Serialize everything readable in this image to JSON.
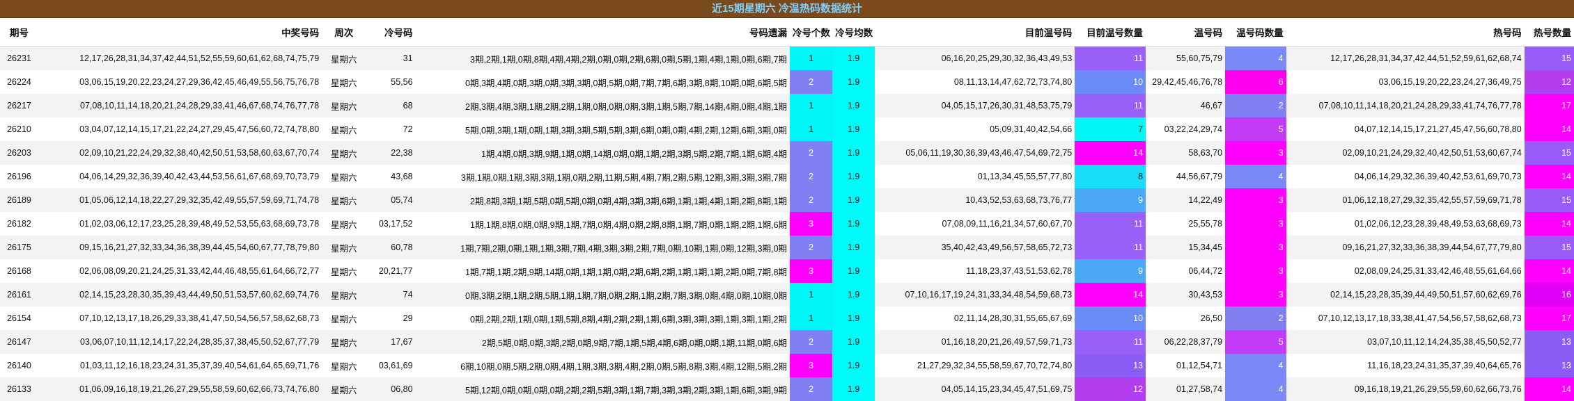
{
  "title": "近15期星期六 冷温热码数据统计",
  "headers": {
    "period": "期号",
    "winning": "中奖号码",
    "weekday": "周次",
    "cold_codes": "冷号码",
    "misses": "号码遗漏",
    "cold_count": "冷号个数",
    "cold_avg": "冷号均数",
    "warm_current": "目前温号码",
    "warm_current_count": "目前温号数量",
    "warm": "温号码",
    "warm_count": "温号码数量",
    "hot": "热号码",
    "hot_count": "热号数量"
  },
  "colors": {
    "title_bg": "#7a4a1c",
    "title_text": "#7fd0ff",
    "value_palette": {
      "1": "#00f7f7",
      "2": "#8080f2",
      "3": "#ff00ff",
      "4": "#7b88f8",
      "5": "#c23cf8",
      "6": "#ff00ee",
      "7": "#00f7f7",
      "8": "#16ddf8",
      "9": "#4aa8f6",
      "10": "#6b8cf8",
      "11": "#9860f6",
      "12": "#b23ef0",
      "13": "#8c5cf6",
      "14": "#ff00ff",
      "15": "#9a5cf8",
      "16": "#e000f8",
      "17": "#ff00ff"
    },
    "cold_avg_bg": "#00fafa"
  },
  "rows": [
    {
      "period": "26231",
      "winning": "12,17,26,28,31,34,37,42,44,51,52,55,59,60,61,62,68,74,75,79",
      "weekday": "星期六",
      "cold": "31",
      "misses": "3期,2期,1期,0期,8期,4期,4期,2期,0期,0期,2期,6期,0期,5期,1期,4期,1期,0期,6期,7期",
      "cold_count": "1",
      "cold_avg": "1.9",
      "warm_current": "06,16,20,25,29,30,32,36,43,49,53",
      "warm_current_count": "11",
      "warm": "55,60,75,79",
      "warm_count": "4",
      "hot": "12,17,26,28,31,34,37,42,44,51,52,59,61,62,68,74",
      "hot_count": "15"
    },
    {
      "period": "26224",
      "winning": "03,06,15,19,20,22,23,24,27,29,36,42,45,46,49,55,56,75,76,78",
      "weekday": "星期六",
      "cold": "55,56",
      "misses": "0期,3期,4期,0期,3期,0期,3期,3期,0期,5期,0期,7期,7期,6期,3期,8期,10期,0期,6期,5期",
      "cold_count": "2",
      "cold_avg": "1.9",
      "warm_current": "08,11,13,14,47,62,72,73,74,80",
      "warm_current_count": "10",
      "warm": "29,42,45,46,76,78",
      "warm_count": "6",
      "hot": "03,06,15,19,20,22,23,24,27,36,49,75",
      "hot_count": "12"
    },
    {
      "period": "26217",
      "winning": "07,08,10,11,14,18,20,21,24,28,29,33,41,46,67,68,74,76,77,78",
      "weekday": "星期六",
      "cold": "68",
      "misses": "2期,3期,4期,3期,1期,2期,2期,1期,0期,0期,0期,3期,1期,5期,7期,14期,4期,0期,4期,1期",
      "cold_count": "1",
      "cold_avg": "1.9",
      "warm_current": "04,05,15,17,26,30,31,48,53,75,79",
      "warm_current_count": "11",
      "warm": "46,67",
      "warm_count": "2",
      "hot": "07,08,10,11,14,18,20,21,24,28,29,33,41,74,76,77,78",
      "hot_count": "17"
    },
    {
      "period": "26210",
      "winning": "03,04,07,12,14,15,17,21,22,24,27,29,45,47,56,60,72,74,78,80",
      "weekday": "星期六",
      "cold": "72",
      "misses": "5期,0期,3期,1期,0期,1期,3期,3期,5期,5期,3期,6期,0期,0期,4期,2期,12期,6期,3期,0期",
      "cold_count": "1",
      "cold_avg": "1.9",
      "warm_current": "05,09,31,40,42,54,66",
      "warm_current_count": "7",
      "warm": "03,22,24,29,74",
      "warm_count": "5",
      "hot": "04,07,12,14,15,17,21,27,45,47,56,60,78,80",
      "hot_count": "14"
    },
    {
      "period": "26203",
      "winning": "02,09,10,21,22,24,29,32,38,40,42,50,51,53,58,60,63,67,70,74",
      "weekday": "星期六",
      "cold": "22,38",
      "misses": "1期,4期,0期,3期,9期,1期,0期,14期,0期,0期,1期,2期,3期,5期,2期,7期,1期,6期,4期",
      "cold_count": "2",
      "cold_avg": "1.9",
      "warm_current": "05,06,11,19,30,36,39,43,46,47,54,69,72,75",
      "warm_current_count": "14",
      "warm": "58,63,70",
      "warm_count": "3",
      "hot": "02,09,10,21,24,29,32,40,42,50,51,53,60,67,74",
      "hot_count": "15"
    },
    {
      "period": "26196",
      "winning": "04,06,14,29,32,36,39,40,42,43,44,53,56,61,67,68,69,70,73,79",
      "weekday": "星期六",
      "cold": "43,68",
      "misses": "3期,1期,0期,1期,3期,3期,1期,0期,2期,11期,5期,4期,7期,2期,5期,12期,3期,3期,3期,7期",
      "cold_count": "2",
      "cold_avg": "1.9",
      "warm_current": "01,13,34,45,55,57,77,80",
      "warm_current_count": "8",
      "warm": "44,56,67,79",
      "warm_count": "4",
      "hot": "04,06,14,29,32,36,39,40,42,53,61,69,70,73",
      "hot_count": "14"
    },
    {
      "period": "26189",
      "winning": "01,05,06,12,14,18,22,27,29,32,35,42,49,55,57,59,69,71,74,78",
      "weekday": "星期六",
      "cold": "05,74",
      "misses": "2期,8期,3期,1期,5期,0期,5期,0期,0期,4期,3期,3期,6期,1期,1期,4期,1期,2期,8期,1期",
      "cold_count": "2",
      "cold_avg": "1.9",
      "warm_current": "10,43,52,53,63,68,73,76,77",
      "warm_current_count": "9",
      "warm": "14,22,49",
      "warm_count": "3",
      "hot": "01,06,12,18,27,29,32,35,42,55,57,59,69,71,78",
      "hot_count": "15"
    },
    {
      "period": "26182",
      "winning": "01,02,03,06,12,17,23,25,28,39,48,49,52,53,55,63,68,69,73,78",
      "weekday": "星期六",
      "cold": "03,17,52",
      "misses": "1期,1期,8期,0期,0期,9期,1期,7期,0期,4期,0期,2期,8期,1期,7期,0期,1期,2期,1期,6期",
      "cold_count": "3",
      "cold_avg": "1.9",
      "warm_current": "07,08,09,11,16,21,34,57,60,67,70",
      "warm_current_count": "11",
      "warm": "25,55,78",
      "warm_count": "3",
      "hot": "01,02,06,12,23,28,39,48,49,53,63,68,69,73",
      "hot_count": "14"
    },
    {
      "period": "26175",
      "winning": "09,15,16,21,27,32,33,34,36,38,39,44,45,54,60,67,77,78,79,80",
      "weekday": "星期六",
      "cold": "60,78",
      "misses": "1期,7期,2期,0期,1期,1期,3期,7期,4期,3期,3期,2期,7期,0期,10期,1期,0期,12期,3期,0期",
      "cold_count": "2",
      "cold_avg": "1.9",
      "warm_current": "35,40,42,43,49,56,57,58,65,72,73",
      "warm_current_count": "11",
      "warm": "15,34,45",
      "warm_count": "3",
      "hot": "09,16,21,27,32,33,36,38,39,44,54,67,77,79,80",
      "hot_count": "15"
    },
    {
      "period": "26168",
      "winning": "02,06,08,09,20,21,24,25,31,33,42,44,46,48,55,61,64,66,72,77",
      "weekday": "星期六",
      "cold": "20,21,77",
      "misses": "1期,7期,1期,2期,9期,14期,0期,1期,1期,0期,2期,6期,2期,1期,1期,1期,2期,0期,7期,8期",
      "cold_count": "3",
      "cold_avg": "1.9",
      "warm_current": "11,18,23,37,43,51,53,62,78",
      "warm_current_count": "9",
      "warm": "06,44,72",
      "warm_count": "3",
      "hot": "02,08,09,24,25,31,33,42,46,48,55,61,64,66",
      "hot_count": "14"
    },
    {
      "period": "26161",
      "winning": "02,14,15,23,28,30,35,39,43,44,49,50,51,53,57,60,62,69,74,76",
      "weekday": "星期六",
      "cold": "74",
      "misses": "0期,3期,2期,1期,2期,5期,1期,1期,7期,0期,2期,1期,2期,7期,3期,0期,4期,0期,10期,0期",
      "cold_count": "1",
      "cold_avg": "1.9",
      "warm_current": "07,10,16,17,19,24,31,33,34,48,54,59,68,73",
      "warm_current_count": "14",
      "warm": "30,43,53",
      "warm_count": "3",
      "hot": "02,14,15,23,28,35,39,44,49,50,51,57,60,62,69,76",
      "hot_count": "16"
    },
    {
      "period": "26154",
      "winning": "07,10,12,13,17,18,26,29,33,38,41,47,50,54,56,57,58,62,68,73",
      "weekday": "星期六",
      "cold": "29",
      "misses": "0期,2期,2期,1期,0期,1期,5期,8期,4期,2期,2期,1期,6期,3期,3期,3期,1期,3期,1期,2期",
      "cold_count": "1",
      "cold_avg": "1.9",
      "warm_current": "02,11,14,28,30,31,55,65,67,69",
      "warm_current_count": "10",
      "warm": "26,50",
      "warm_count": "2",
      "hot": "07,10,12,13,17,18,33,38,41,47,54,56,57,58,62,68,73",
      "hot_count": "17"
    },
    {
      "period": "26147",
      "winning": "03,06,07,10,11,12,14,17,22,24,28,35,37,38,45,50,52,67,77,79",
      "weekday": "星期六",
      "cold": "17,67",
      "misses": "2期,5期,0期,0期,3期,2期,0期,9期,7期,1期,5期,4期,6期,0期,0期,1期,11期,0期,6期",
      "cold_count": "2",
      "cold_avg": "1.9",
      "warm_current": "01,16,18,20,21,26,49,57,59,71,73",
      "warm_current_count": "11",
      "warm": "06,22,28,37,79",
      "warm_count": "5",
      "hot": "03,07,10,11,12,14,24,35,38,45,50,52,77",
      "hot_count": "13"
    },
    {
      "period": "26140",
      "winning": "01,03,11,12,16,18,23,24,31,35,37,39,40,54,61,64,65,69,71,76",
      "weekday": "星期六",
      "cold": "03,61,69",
      "misses": "6期,10期,0期,5期,2期,0期,4期,1期,3期,3期,4期,2期,0期,5期,8期,3期,4期,12期,5期,2期",
      "cold_count": "3",
      "cold_avg": "1.9",
      "warm_current": "21,27,29,32,34,55,58,59,67,70,72,74,80",
      "warm_current_count": "13",
      "warm": "01,12,54,71",
      "warm_count": "4",
      "hot": "11,16,18,23,24,31,35,37,39,40,64,65,76",
      "hot_count": "13"
    },
    {
      "period": "26133",
      "winning": "01,06,09,16,18,19,21,26,27,29,55,58,59,60,62,66,73,74,76,80",
      "weekday": "星期六",
      "cold": "06,80",
      "misses": "5期,12期,0期,0期,0期,0期,2期,2期,5期,3期,1期,7期,3期,3期,2期,3期,1期,6期,3期,9期",
      "cold_count": "2",
      "cold_avg": "1.9",
      "warm_current": "04,05,14,15,23,34,45,47,51,69,75",
      "warm_current_count": "12",
      "warm": "01,27,58,74",
      "warm_count": "4",
      "hot": "09,16,18,19,21,26,29,55,59,60,62,66,73,76",
      "hot_count": "14"
    }
  ]
}
